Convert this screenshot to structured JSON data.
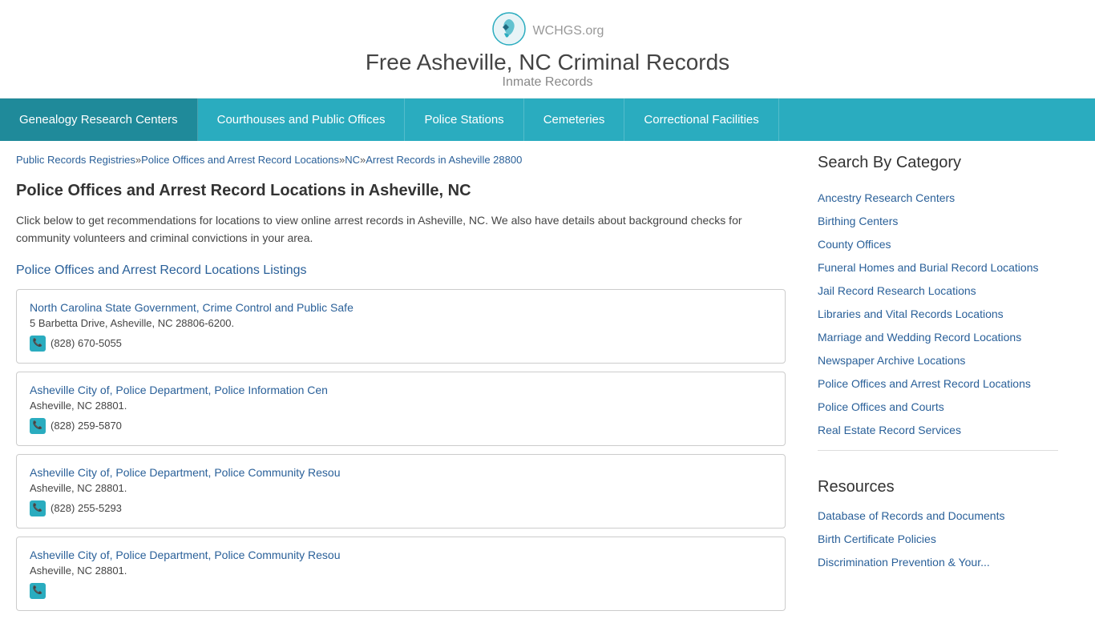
{
  "header": {
    "logo_text": "WCHGS",
    "logo_suffix": ".org",
    "site_title": "Free Asheville, NC Criminal Records",
    "site_subtitle": "Inmate Records"
  },
  "nav": {
    "items": [
      {
        "label": "Genealogy Research Centers",
        "active": true
      },
      {
        "label": "Courthouses and Public Offices"
      },
      {
        "label": "Police Stations"
      },
      {
        "label": "Cemeteries"
      },
      {
        "label": "Correctional Facilities"
      }
    ]
  },
  "breadcrumb": {
    "items": [
      {
        "label": "Public Records Registries",
        "href": "#"
      },
      {
        "label": "Police Offices and Arrest Record Locations",
        "href": "#"
      },
      {
        "label": "NC",
        "href": "#"
      },
      {
        "label": "Arrest Records in Asheville 28800",
        "href": "#",
        "last": true
      }
    ],
    "separator": "»"
  },
  "main": {
    "page_heading": "Police Offices and Arrest Record Locations in Asheville, NC",
    "page_description": "Click below to get recommendations for locations to view online arrest records in Asheville, NC. We also have details about background checks for community volunteers and criminal convictions in your area.",
    "listings_heading": "Police Offices and Arrest Record Locations Listings",
    "listings": [
      {
        "name": "North Carolina State Government, Crime Control and Public Safe",
        "address": "5 Barbetta Drive, Asheville, NC 28806-6200.",
        "phone": "(828) 670-5055"
      },
      {
        "name": "Asheville City of, Police Department, Police Information Cen",
        "address": "Asheville, NC 28801.",
        "phone": "(828) 259-5870"
      },
      {
        "name": "Asheville City of, Police Department, Police Community Resou",
        "address": "Asheville, NC 28801.",
        "phone": "(828) 255-5293"
      },
      {
        "name": "Asheville City of, Police Department, Police Community Resou",
        "address": "Asheville, NC 28801.",
        "phone": ""
      }
    ]
  },
  "sidebar": {
    "search_heading": "Search By Category",
    "categories": [
      "Ancestry Research Centers",
      "Birthing Centers",
      "County Offices",
      "Funeral Homes and Burial Record Locations",
      "Jail Record Research Locations",
      "Libraries and Vital Records Locations",
      "Marriage and Wedding Record Locations",
      "Newspaper Archive Locations",
      "Police Offices and Arrest Record Locations",
      "Police Offices and Courts",
      "Real Estate Record Services"
    ],
    "resources_heading": "Resources",
    "resources": [
      "Database of Records and Documents",
      "Birth Certificate Policies",
      "Discrimination Prevention & Your..."
    ]
  }
}
